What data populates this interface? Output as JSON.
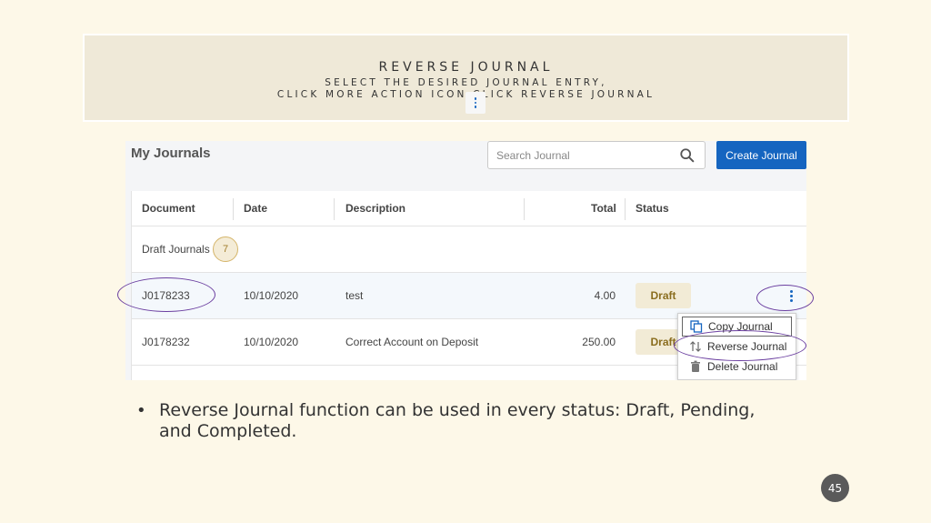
{
  "slide": {
    "title": "REVERSE JOURNAL",
    "subtitle_line1": "SELECT THE DESIRED JOURNAL ENTRY,",
    "subtitle_line2": "CLICK MORE ACTION ICON    CLICK REVERSE JOURNAL",
    "bullet": "Reverse Journal function can be used in every status: Draft, Pending, and Completed.",
    "page_number": "45"
  },
  "app": {
    "page_title": "My Journals",
    "search_placeholder": "Search Journal",
    "create_button": "Create Journal",
    "columns": {
      "document": "Document",
      "date": "Date",
      "description": "Description",
      "total": "Total",
      "status": "Status"
    },
    "group": {
      "label": "Draft Journals",
      "count": "7"
    },
    "rows": [
      {
        "document": "J0178233",
        "date": "10/10/2020",
        "description": "test",
        "total": "4.00",
        "status": "Draft"
      },
      {
        "document": "J0178232",
        "date": "10/10/2020",
        "description": "Correct Account on Deposit",
        "total": "250.00",
        "status": "Draft"
      }
    ],
    "menu": {
      "copy": "Copy Journal",
      "reverse": "Reverse Journal",
      "delete": "Delete Journal"
    }
  },
  "colors": {
    "background": "#fdf8e8",
    "banner": "#efe9d8",
    "accent_blue": "#1565c0",
    "annotation_purple": "#6b3fa0",
    "draft_badge": "#f2ebd6"
  },
  "icons": [
    "more-vertical-icon",
    "search-icon",
    "copy-icon",
    "reverse-icon",
    "trash-icon"
  ]
}
